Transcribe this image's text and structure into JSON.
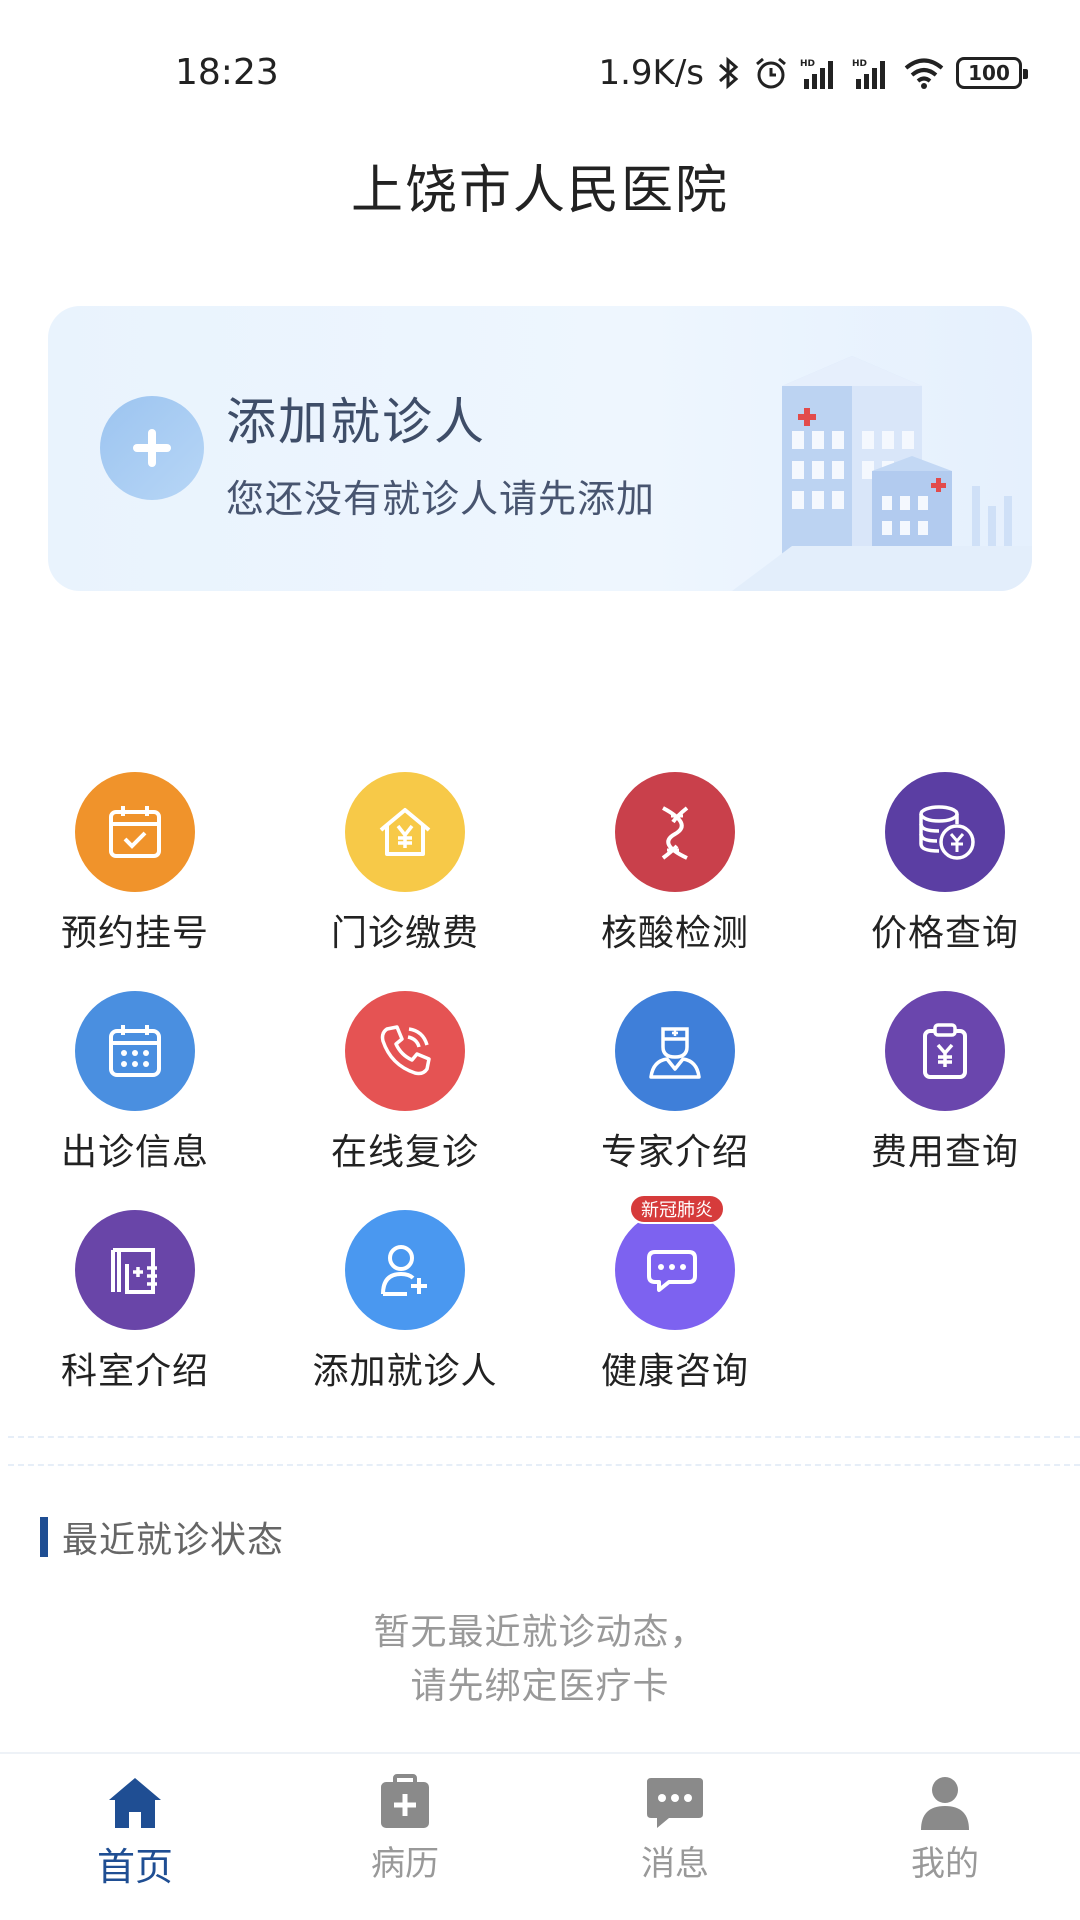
{
  "status_bar": {
    "time": "18:23",
    "network_speed": "1.9K/s",
    "battery": "100",
    "icons": [
      "bluetooth-icon",
      "alarm-icon",
      "signal-hd-icon",
      "signal-hd-icon",
      "wifi-icon",
      "battery-icon"
    ]
  },
  "header": {
    "title": "上饶市人民医院"
  },
  "patient_card": {
    "title": "添加就诊人",
    "subtitle": "您还没有就诊人请先添加",
    "icon": "plus-icon"
  },
  "services": [
    {
      "label": "预约挂号",
      "icon": "calendar-check-icon",
      "color": "#f0932b"
    },
    {
      "label": "门诊缴费",
      "icon": "house-yen-icon",
      "color": "#f7c948"
    },
    {
      "label": "核酸检测",
      "icon": "dna-icon",
      "color": "#c9404b"
    },
    {
      "label": "价格查询",
      "icon": "coins-yen-icon",
      "color": "#5b3ea3"
    },
    {
      "label": "出诊信息",
      "icon": "calendar-grid-icon",
      "color": "#4a8fe0"
    },
    {
      "label": "在线复诊",
      "icon": "phone-icon",
      "color": "#e55353"
    },
    {
      "label": "专家介绍",
      "icon": "doctor-icon",
      "color": "#3f7fd9"
    },
    {
      "label": "费用查询",
      "icon": "clipboard-yen-icon",
      "color": "#6a46ad"
    },
    {
      "label": "科室介绍",
      "icon": "department-icon",
      "color": "#6945a8"
    },
    {
      "label": "添加就诊人",
      "icon": "add-user-icon",
      "color": "#4a98f0"
    },
    {
      "label": "健康咨询",
      "icon": "chat-icon",
      "color": "#7d62f0",
      "badge": "新冠肺炎"
    }
  ],
  "recent": {
    "title": "最近就诊状态",
    "empty_line1": "暂无最近就诊动态，",
    "empty_line2": "请先绑定医疗卡"
  },
  "tabs": [
    {
      "label": "首页",
      "icon": "home-icon",
      "active": true
    },
    {
      "label": "病历",
      "icon": "medical-record-icon",
      "active": false
    },
    {
      "label": "消息",
      "icon": "message-icon",
      "active": false
    },
    {
      "label": "我的",
      "icon": "user-icon",
      "active": false
    }
  ],
  "colors": {
    "primary": "#1f4e93",
    "inactive_tab": "#999999",
    "card_bg": "#eaf4fe"
  }
}
